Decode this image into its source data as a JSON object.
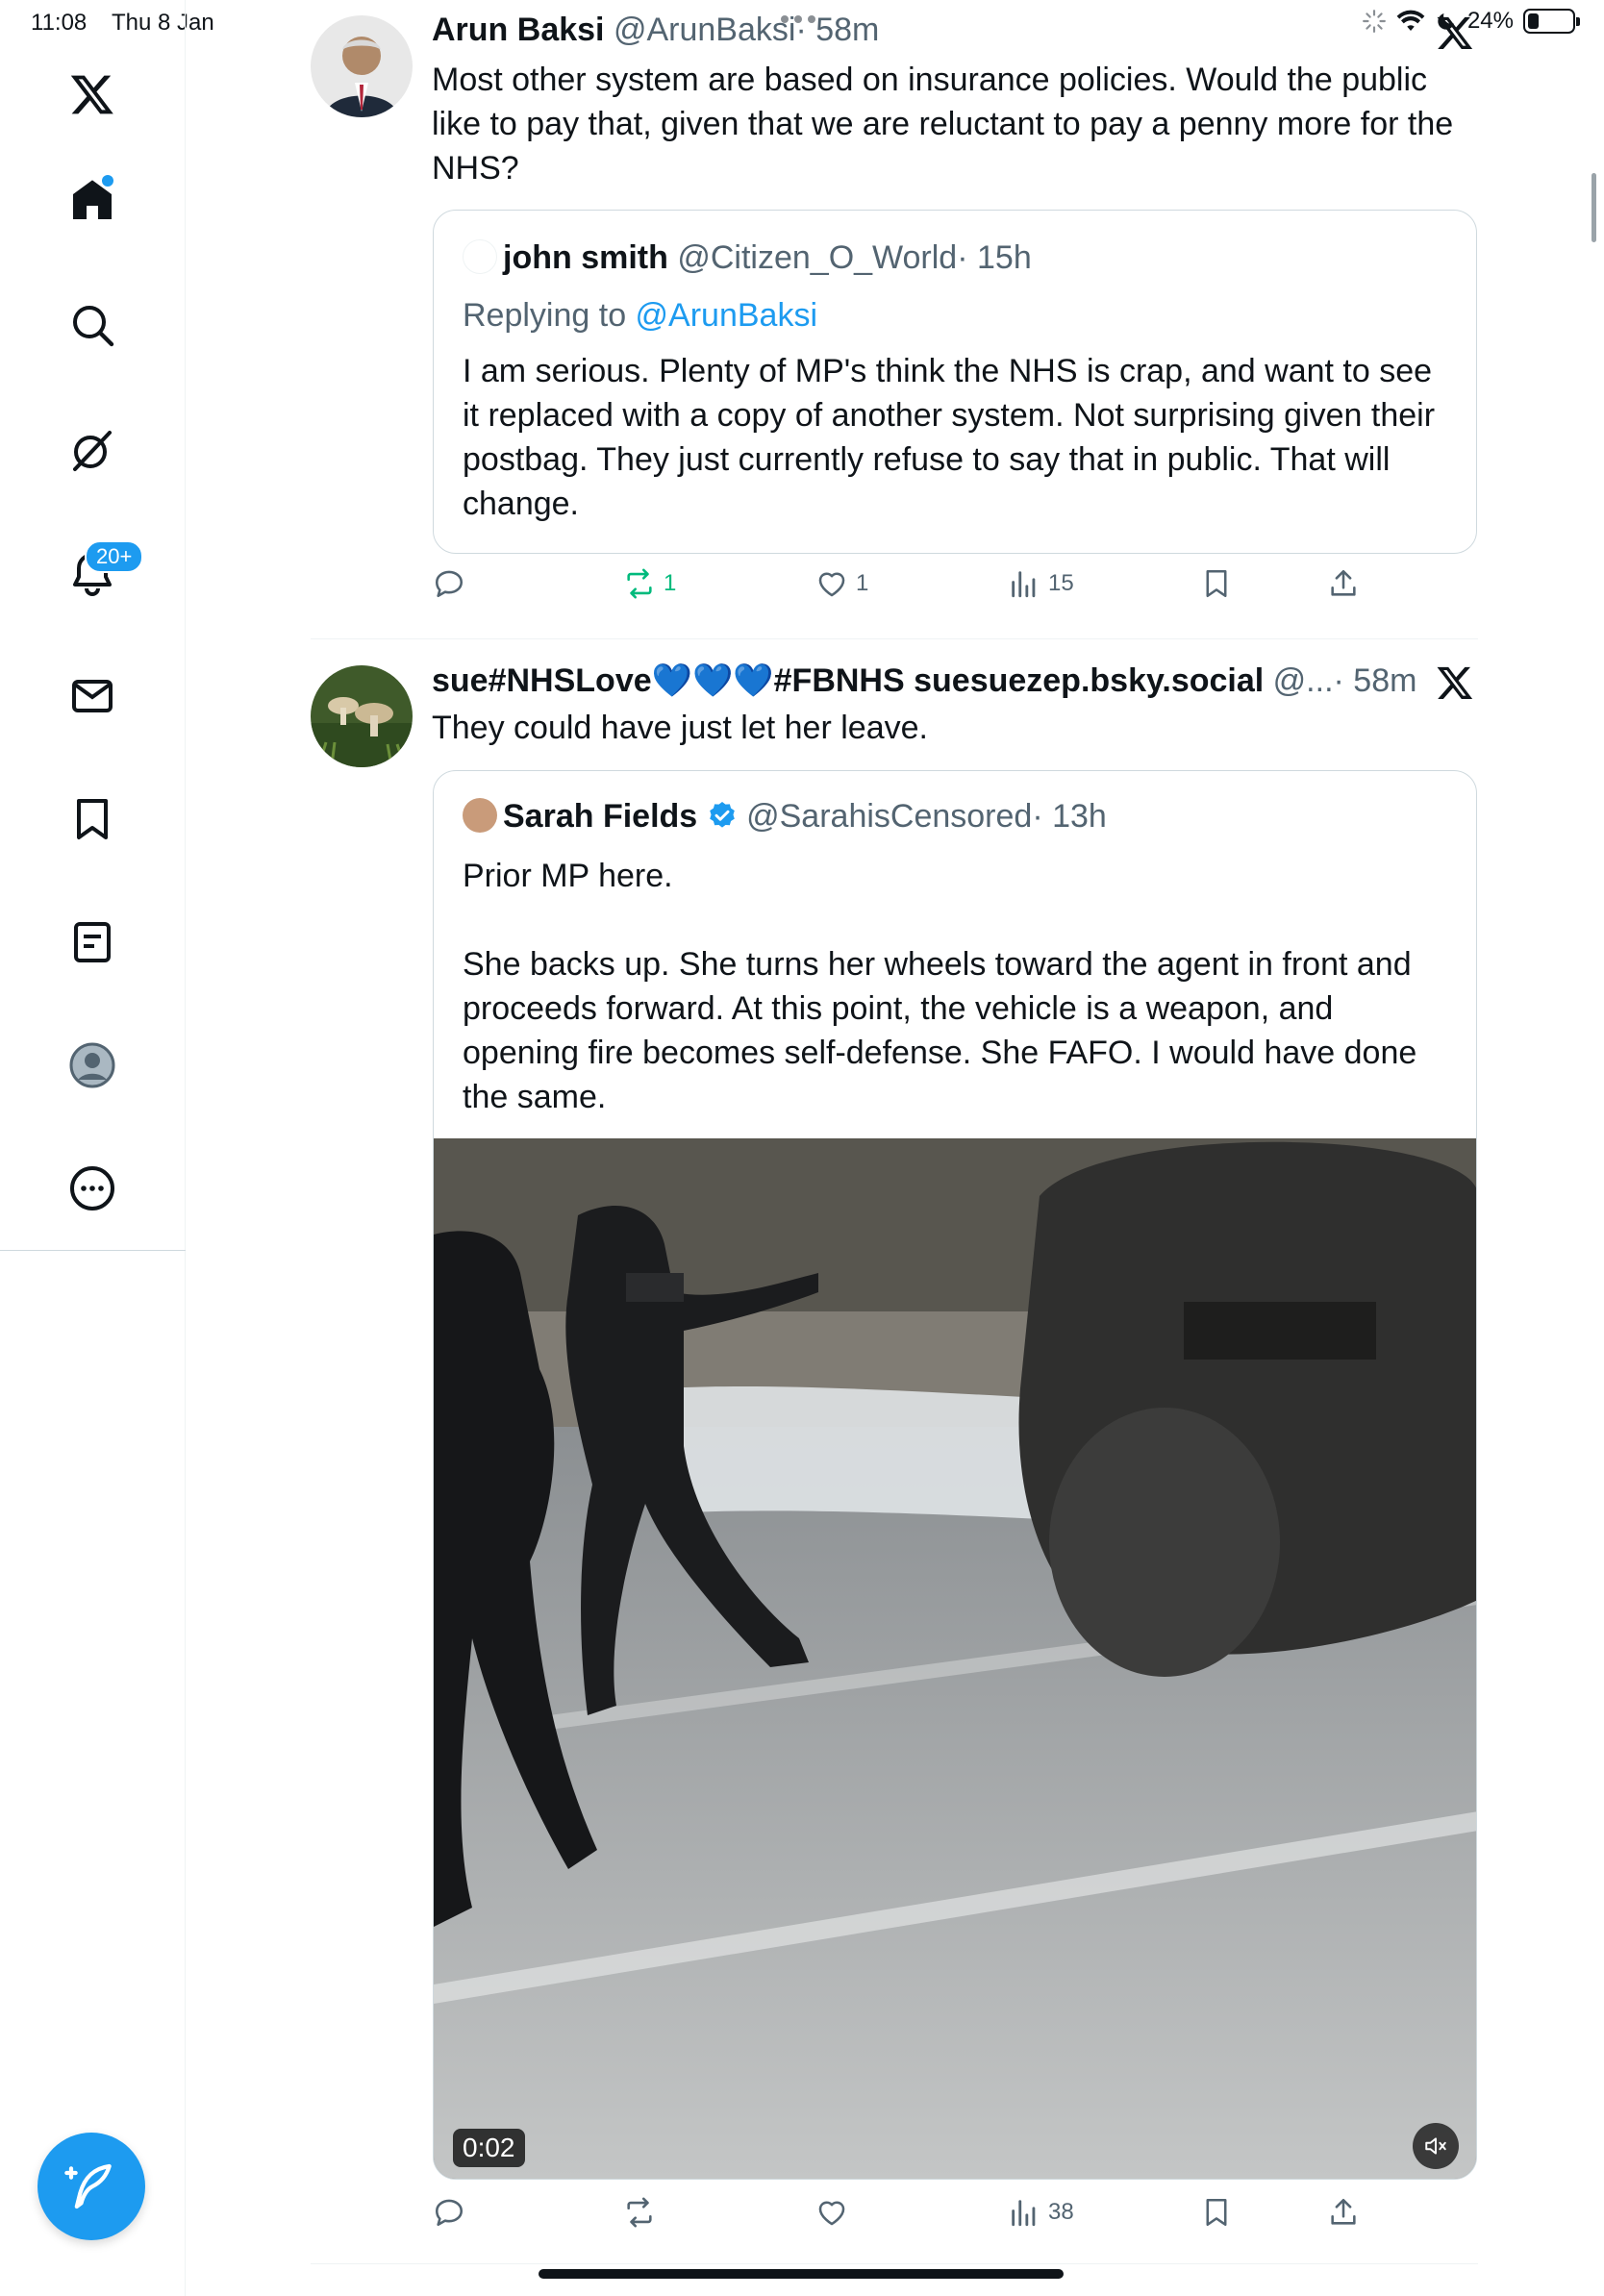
{
  "status_bar": {
    "time": "11:08",
    "date": "Thu 8 Jan",
    "battery": "24%",
    "battery_level": 0.24
  },
  "sidebar": {
    "notifications_badge": "20+",
    "items": [
      "logo",
      "home",
      "search",
      "grok",
      "notifications",
      "messages",
      "bookmarks",
      "lists",
      "profile",
      "more"
    ]
  },
  "posts": [
    {
      "name": "Arun Baksi",
      "handle": "@ArunBaksi",
      "time": "· 58m",
      "text": "Most other system are based on insurance policies. Would the public like to pay that, given that we are reluctant to pay a penny more for the NHS?",
      "quote": {
        "name": "john smith",
        "handle": "@Citizen_O_World",
        "time": "· 15h",
        "replying_prefix": "Replying to ",
        "replying_to": "@ArunBaksi",
        "text": "I am serious. Plenty of MP's think the NHS is crap, and want to see it replaced with a copy of another system. Not surprising given their postbag. They just currently refuse to say that in public. That will change."
      },
      "actions": {
        "replies": "",
        "reposts": "1",
        "likes": "1",
        "views": "15"
      }
    },
    {
      "name": "sue#NHSLove💙💙💙#FBNHS suesuezep.bsky.social",
      "handle": "@...",
      "time": "· 58m",
      "text": "They could have just let her leave.",
      "quote": {
        "name": "Sarah Fields",
        "handle": "@SarahisCensored",
        "time": "· 13h",
        "text_p1": "Prior MP here.",
        "text_p2": "She backs up. She turns her wheels toward the agent in front and proceeds forward. At this point, the vehicle is a weapon, and opening fire becomes self-defense. She FAFO. I would have done the same.",
        "video_time": "0:02"
      },
      "actions": {
        "replies": "",
        "reposts": "",
        "likes": "",
        "views": "38"
      }
    }
  ],
  "colors": {
    "accent": "#1d9bf0",
    "repost": "#00ba7c",
    "secondary_text": "#536471",
    "border": "#cfd9de"
  }
}
